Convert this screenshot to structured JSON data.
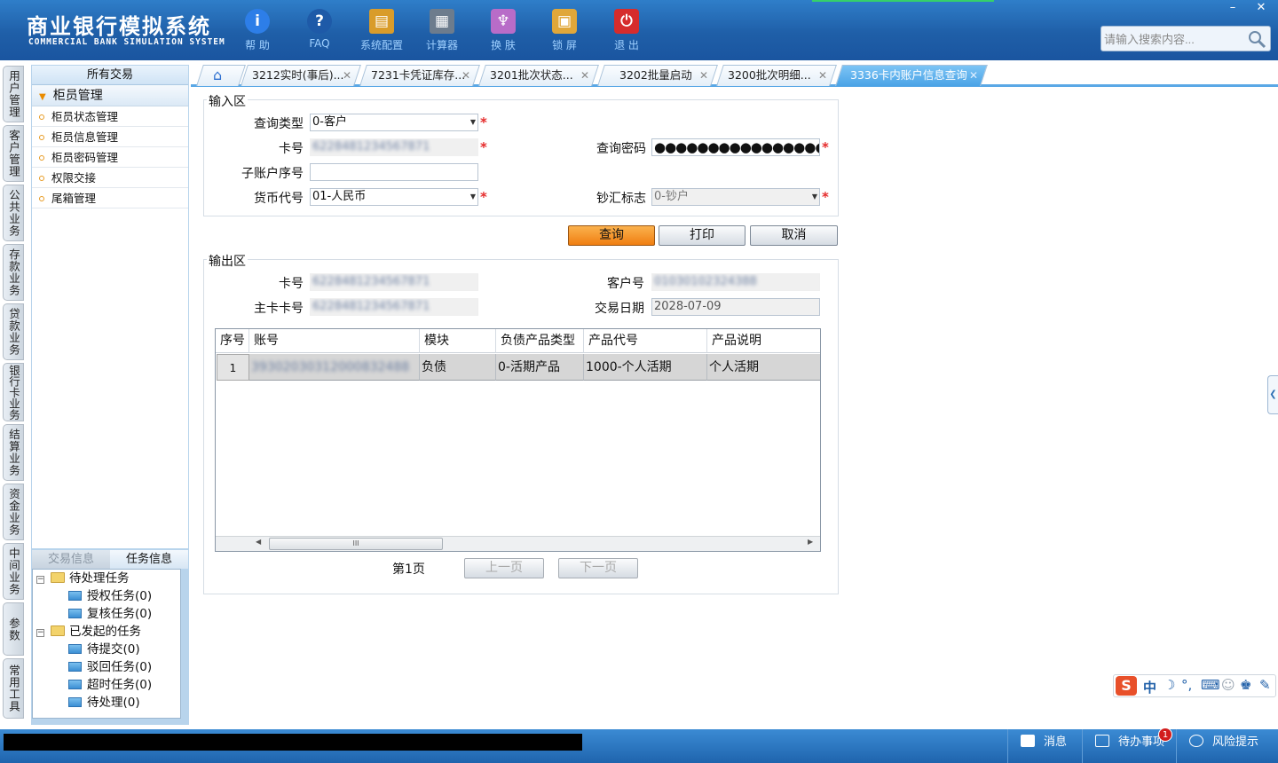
{
  "app": {
    "title": "商业银行模拟系统",
    "subtitle": "COMMERCIAL BANK SIMULATION SYSTEM"
  },
  "toolbar": [
    {
      "label": "帮 助",
      "icon": "help-icon",
      "color": "#2d7ee8"
    },
    {
      "label": "FAQ",
      "icon": "faq-icon",
      "color": "#1e5aa8"
    },
    {
      "label": "系统配置",
      "icon": "toolbox-icon",
      "color": "#d99c2a"
    },
    {
      "label": "计算器",
      "icon": "calculator-icon",
      "color": "#6d7c8d"
    },
    {
      "label": "换 肤",
      "icon": "shirt-icon",
      "color": "#b86cc8"
    },
    {
      "label": "锁 屏",
      "icon": "lock-icon",
      "color": "#e0a73a"
    },
    {
      "label": "退 出",
      "icon": "power-icon",
      "color": "#d62c2c"
    }
  ],
  "window_controls": {
    "minimize": "–",
    "close": "✕"
  },
  "search": {
    "placeholder": "请输入搜索内容..."
  },
  "vertical_tabs": [
    "用户管理",
    "客户管理",
    "公共业务",
    "存款业务",
    "贷款业务",
    "银行卡业务",
    "结算业务",
    "资金业务",
    "中间业务",
    "参数",
    "常用工具"
  ],
  "nav": {
    "header": "所有交易",
    "group": "柜员管理",
    "items": [
      "柜员状态管理",
      "柜员信息管理",
      "柜员密码管理",
      "权限交接",
      "尾箱管理"
    ]
  },
  "task_panel": {
    "tabs": [
      "交易信息",
      "任务信息"
    ],
    "tree": {
      "pending": "待处理任务",
      "auth": "授权任务(0)",
      "review": "复核任务(0)",
      "initiated": "已发起的任务",
      "to_submit": "待提交(0)",
      "rejected": "驳回任务(0)",
      "timeout": "超时任务(0)",
      "processing": "待处理(0)"
    }
  },
  "tabs": [
    {
      "label": "3212实时(事后)..."
    },
    {
      "label": "7231卡凭证库存..."
    },
    {
      "label": "3201批次状态..."
    },
    {
      "label": "3202批量启动"
    },
    {
      "label": "3200批次明细..."
    },
    {
      "label": "3336卡内账户信息查询",
      "active": true
    }
  ],
  "input_area": {
    "legend": "输入区",
    "query_type_label": "查询类型",
    "query_type_value": "0-客户",
    "card_no_label": "卡号",
    "card_no_value": "6228481234567871",
    "query_pwd_label": "查询密码",
    "query_pwd_value": "●●●●●●●●●●●●●●●●",
    "sub_account_label": "子账户序号",
    "sub_account_value": "",
    "currency_label": "货币代号",
    "currency_value": "01-人民币",
    "cash_flag_label": "钞汇标志",
    "cash_flag_value": "0-钞户"
  },
  "buttons": {
    "query": "查询",
    "print": "打印",
    "cancel": "取消"
  },
  "output_area": {
    "legend": "输出区",
    "card_no_label": "卡号",
    "card_no_value": "6228481234567871",
    "customer_no_label": "客户号",
    "customer_no_value": "01030102324388",
    "main_card_label": "主卡卡号",
    "main_card_value": "6228481234567871",
    "trade_date_label": "交易日期",
    "trade_date_value": "2028-07-09"
  },
  "grid": {
    "columns": [
      "序号",
      "账号",
      "模块",
      "负债产品类型",
      "产品代号",
      "产品说明"
    ],
    "rows": [
      [
        "1",
        "39302030312000832488",
        "负债",
        "0-活期产品",
        "1000-个人活期",
        "个人活期"
      ]
    ],
    "scroll_thumb": "III"
  },
  "pager": {
    "page": "第1页",
    "prev": "上一页",
    "next": "下一页"
  },
  "statusbar": {
    "messages": "消息",
    "todo": "待办事项",
    "todo_badge": "1",
    "risk": "风险提示"
  }
}
